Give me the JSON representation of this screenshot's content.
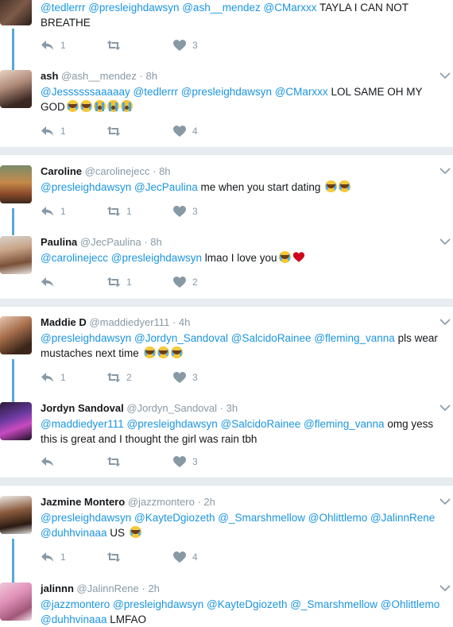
{
  "colors": {
    "mention": "#1b95e0",
    "thread_line": "#58a8d8",
    "icon": "#8899a6",
    "separator": "#e6ecf0"
  },
  "tweets": [
    {
      "name": "",
      "handle": "",
      "time": "",
      "text": [
        {
          "m": "@tedlerrr @presleighdawsyn @ash__mendez @CMarxxx"
        },
        {
          "t": " TAYLA I CAN NOT BREATHE"
        }
      ],
      "reply": "1",
      "retweet": "",
      "like": "3"
    },
    {
      "name": "ash",
      "handle": "@ash__mendez",
      "time": "8h",
      "text": [
        {
          "m": "@Jessssssaaaaay @tedlerrr @presleighdawsyn @CMarxxx"
        },
        {
          "t": " LOL SAME OH MY GOD"
        },
        {
          "e": "cry"
        },
        {
          "e": "cry"
        },
        {
          "e": "sob"
        },
        {
          "e": "sob"
        },
        {
          "e": "sob"
        }
      ],
      "reply": "1",
      "retweet": "",
      "like": "4"
    },
    {
      "name": "Caroline",
      "handle": "@carolinejecc",
      "time": "8h",
      "text": [
        {
          "m": "@presleighdawsyn @JecPaulina"
        },
        {
          "t": " me when you start dating "
        },
        {
          "e": "cry"
        },
        {
          "e": "cry"
        }
      ],
      "reply": "1",
      "retweet": "1",
      "like": "3"
    },
    {
      "name": "Paulina",
      "handle": "@JecPaulina",
      "time": "8h",
      "text": [
        {
          "m": "@carolinejecc @presleighdawsyn"
        },
        {
          "t": " lmao I love you"
        },
        {
          "e": "cry"
        },
        {
          "e": "heart"
        }
      ],
      "reply": "",
      "retweet": "1",
      "like": "2"
    },
    {
      "name": "Maddie D",
      "handle": "@maddiedyer111",
      "time": "4h",
      "text": [
        {
          "m": "@presleighdawsyn @Jordyn_Sandoval @SalcidoRainee @fleming_vanna"
        },
        {
          "t": " pls wear mustaches next time "
        },
        {
          "e": "cry"
        },
        {
          "e": "cry"
        },
        {
          "e": "cry"
        }
      ],
      "reply": "1",
      "retweet": "2",
      "like": "3"
    },
    {
      "name": "Jordyn Sandoval",
      "handle": "@Jordyn_Sandoval",
      "time": "3h",
      "text": [
        {
          "m": "@maddiedyer111 @presleighdawsyn @SalcidoRainee @fleming_vanna"
        },
        {
          "t": " omg yess this is great and I thought the girl was rain tbh"
        }
      ],
      "reply": "",
      "retweet": "",
      "like": "3"
    },
    {
      "name": "Jazmine Montero",
      "handle": "@jazzmontero",
      "time": "2h",
      "text": [
        {
          "m": "@presleighdawsyn @KayteDgiozeth @_Smarshmellow @Ohlittlemo @JalinnRene @duhhvinaaa"
        },
        {
          "t": " US "
        },
        {
          "e": "cry"
        }
      ],
      "reply": "1",
      "retweet": "",
      "like": "4"
    },
    {
      "name": "jalinnn",
      "handle": "@JalinnRene",
      "time": "2h",
      "text": [
        {
          "m": "@jazzmontero @presleighdawsyn @KayteDgiozeth @_Smarshmellow @Ohlittlemo @duhhvinaaa"
        },
        {
          "t": " LMFAO"
        }
      ],
      "reply": "",
      "retweet": "",
      "like": ""
    }
  ]
}
